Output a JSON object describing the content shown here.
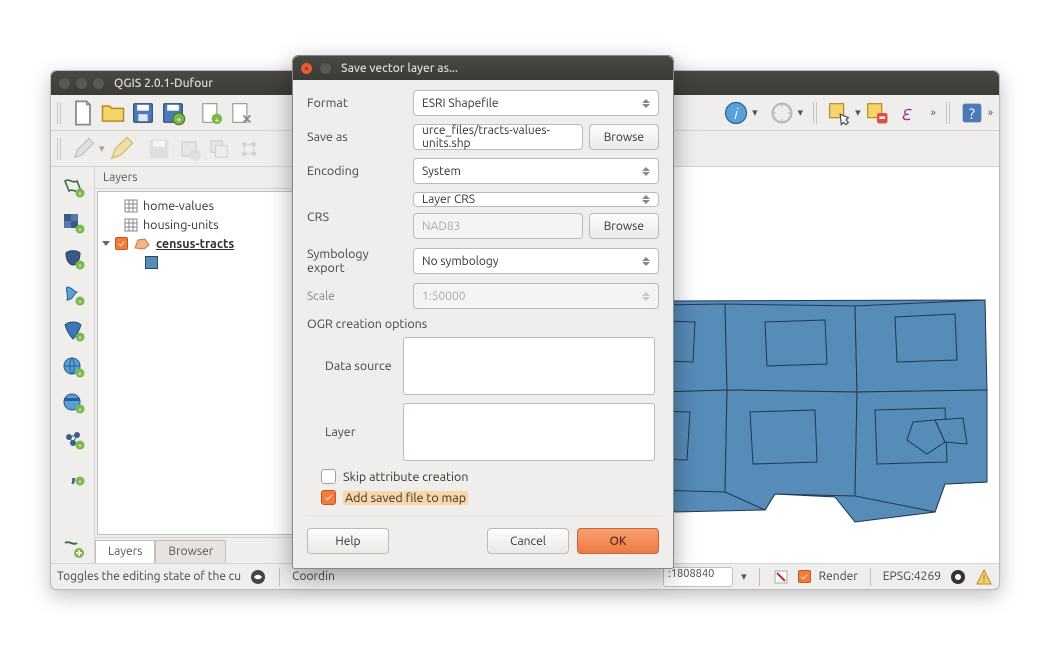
{
  "main_window": {
    "title": "QGIS 2.0.1-Dufour"
  },
  "layers_panel": {
    "header": "Layers",
    "items": [
      {
        "name": "home-values"
      },
      {
        "name": "housing-units"
      },
      {
        "name": "census-tracts"
      }
    ],
    "tabs": {
      "layers": "Layers",
      "browser": "Browser"
    }
  },
  "statusbar": {
    "message": "Toggles the editing state of the cu",
    "coord_label": "Coordin",
    "scale": ":1808840",
    "render": "Render",
    "epsg": "EPSG:4269"
  },
  "dialog": {
    "title": "Save vector layer as...",
    "labels": {
      "format": "Format",
      "save_as": "Save as",
      "encoding": "Encoding",
      "crs": "CRS",
      "symbology": "Symbology export",
      "scale": "Scale",
      "ogr": "OGR creation options",
      "data_source": "Data source",
      "layer": "Layer",
      "skip_attr": "Skip attribute creation",
      "add_to_map": "Add saved file to map"
    },
    "values": {
      "format": "ESRI Shapefile",
      "save_as": "urce_files/tracts-values-units.shp",
      "encoding": "System",
      "crs_mode": "Layer CRS",
      "crs": "NAD83",
      "symbology": "No symbology",
      "scale": "1:50000"
    },
    "buttons": {
      "browse": "Browse",
      "help": "Help",
      "cancel": "Cancel",
      "ok": "OK"
    }
  }
}
